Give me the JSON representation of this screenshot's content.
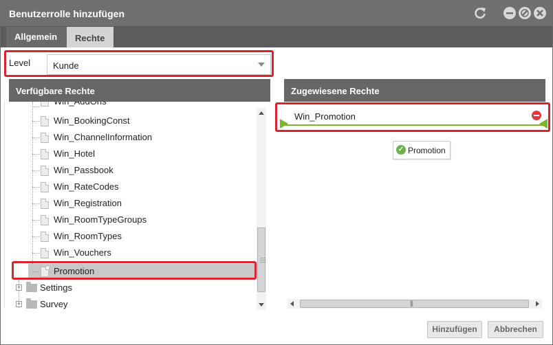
{
  "dialog": {
    "title": "Benutzerrolle hinzufügen",
    "icons": [
      "refresh-icon",
      "minimize-icon",
      "restore-icon",
      "close-icon"
    ]
  },
  "tabs": [
    {
      "label": "Allgemein",
      "active": false
    },
    {
      "label": "Rechte",
      "active": true
    }
  ],
  "level": {
    "label": "Level",
    "value": "Kunde"
  },
  "available": {
    "header": "Verfügbare Rechte",
    "partial_top": "Win_AddOns",
    "items": [
      "Win_BookingConst",
      "Win_ChannelInformation",
      "Win_Hotel",
      "Win_Passbook",
      "Win_RateCodes",
      "Win_Registration",
      "Win_RoomTypeGroups",
      "Win_RoomTypes",
      "Win_Vouchers",
      "Promotion"
    ],
    "folders": [
      "Settings",
      "Survey"
    ]
  },
  "assigned": {
    "header": "Zugewiesene Rechte",
    "item": "Win_Promotion",
    "chip": "Promotion"
  },
  "buttons": {
    "add": "Hinzufügen",
    "cancel": "Abbrechen"
  },
  "colors": {
    "titlebar": "#6f6f6f",
    "panel_header": "#666666",
    "highlight": "#d9232d",
    "assigned_line": "#76b82a",
    "remove": "#e2383f",
    "check": "#69b24c"
  }
}
